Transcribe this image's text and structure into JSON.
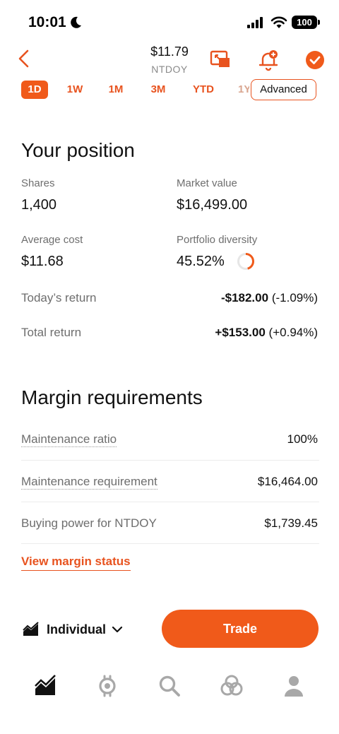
{
  "status_bar": {
    "time": "10:01",
    "battery": "100"
  },
  "header": {
    "price": "$11.79",
    "symbol": "NTDOY"
  },
  "range_tabs": [
    "1D",
    "1W",
    "1M",
    "3M",
    "YTD",
    "1Y"
  ],
  "advanced_label": "Advanced",
  "position": {
    "title": "Your position",
    "shares_label": "Shares",
    "shares_value": "1,400",
    "market_value_label": "Market value",
    "market_value": "$16,499.00",
    "average_cost_label": "Average cost",
    "average_cost": "$11.68",
    "diversity_label": "Portfolio diversity",
    "diversity_value": "45.52%",
    "diversity_fraction": 0.4552,
    "todays_return_label": "Today’s return",
    "todays_return_amount": "-$182.00",
    "todays_return_pct": "(-1.09%)",
    "total_return_label": "Total return",
    "total_return_amount": "+$153.00",
    "total_return_pct": "(+0.94%)"
  },
  "margin": {
    "title": "Margin requirements",
    "maintenance_ratio_label": "Maintenance ratio",
    "maintenance_ratio": "100%",
    "maintenance_req_label": "Maintenance requirement",
    "maintenance_req": "$16,464.00",
    "buying_power_label": "Buying power for NTDOY",
    "buying_power": "$1,739.45",
    "view_link": "View margin status"
  },
  "bottom": {
    "account": "Individual",
    "trade_label": "Trade"
  },
  "nav": [
    "chart-icon",
    "crypto-icon",
    "search-icon",
    "network-icon",
    "profile-icon"
  ],
  "colors": {
    "accent": "#f05a1a",
    "text": "#111111",
    "muted": "#6e6e6e"
  }
}
